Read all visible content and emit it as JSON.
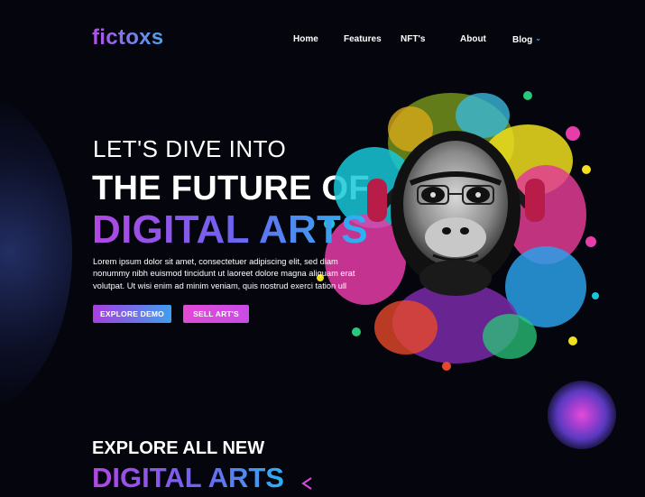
{
  "brand": {
    "logo": "fictoxs"
  },
  "nav": {
    "items": [
      {
        "label": "Home"
      },
      {
        "label": "Features"
      },
      {
        "label": "NFT's"
      },
      {
        "label": "About"
      },
      {
        "label": "Blog"
      }
    ],
    "blog_has_dropdown": true
  },
  "hero": {
    "pre_title": "LET'S DIVE INTO",
    "title": "THE FUTURE OF",
    "accent": "DIGITAL ARTS",
    "description": "Lorem ipsum dolor sit amet, consectetuer adipiscing elit, sed diam nonummy nibh euismod tincidunt ut laoreet dolore magna aliquam erat volutpat. Ut wisi enim ad minim veniam, quis nostrud exerci tation ull",
    "buttons": {
      "primary": "EXPLORE DEMO",
      "secondary": "SELL ART'S"
    },
    "art_icon": "chimpanzee-headphones-splash-art"
  },
  "section2": {
    "title": "EXPLORE ALL NEW",
    "accent": "DIGITAL ARTS"
  },
  "colors": {
    "background": "#04050d",
    "gradient_purple": "#b247e2",
    "gradient_blue": "#27b6f2",
    "pink": "#e24ad6",
    "chevron_blue": "#5ab0ff"
  }
}
